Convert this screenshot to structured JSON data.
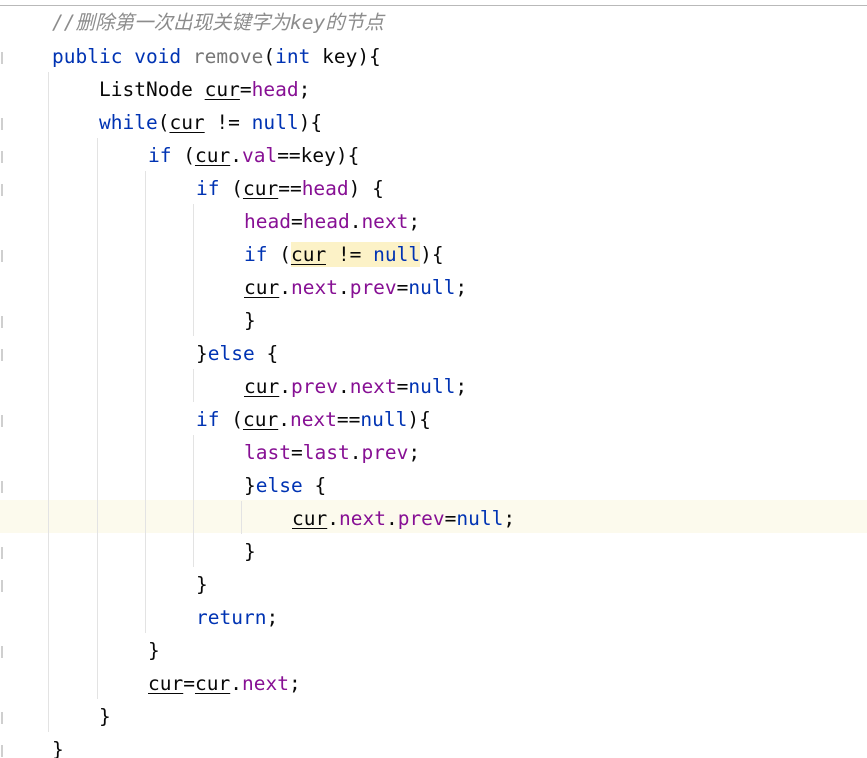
{
  "editor": {
    "language": "Java",
    "current_line_index": 15,
    "colors": {
      "keyword": "#0033b3",
      "field": "#871094",
      "comment": "#8c8c8c",
      "method_unused": "#777777",
      "plain": "#080808",
      "current_line_background": "#fcfaed",
      "match_highlight": "#fcf2c7"
    },
    "lines": [
      {
        "tokens": [
          {
            "t": "//",
            "c": "comment comment-mono"
          },
          {
            "t": "删除第一次出现关键字为",
            "c": "comment"
          },
          {
            "t": "key",
            "c": "comment comment-mono"
          },
          {
            "t": "的节点",
            "c": "comment"
          }
        ]
      },
      {
        "tokens": [
          {
            "t": "public",
            "c": "kw"
          },
          {
            "t": " "
          },
          {
            "t": "void",
            "c": "kw"
          },
          {
            "t": " "
          },
          {
            "t": "remove",
            "c": "gray-method"
          },
          {
            "t": "("
          },
          {
            "t": "int",
            "c": "kw"
          },
          {
            "t": " key){"
          }
        ]
      },
      {
        "tokens": [
          {
            "t": "ListNode "
          },
          {
            "t": "cur",
            "c": "var"
          },
          {
            "t": "="
          },
          {
            "t": "head",
            "c": "field"
          },
          {
            "t": ";"
          }
        ]
      },
      {
        "tokens": [
          {
            "t": "while",
            "c": "kw"
          },
          {
            "t": "("
          },
          {
            "t": "cur",
            "c": "var"
          },
          {
            "t": " != "
          },
          {
            "t": "null",
            "c": "kw"
          },
          {
            "t": "){"
          }
        ]
      },
      {
        "tokens": [
          {
            "t": "if",
            "c": "kw"
          },
          {
            "t": " ("
          },
          {
            "t": "cur",
            "c": "var"
          },
          {
            "t": "."
          },
          {
            "t": "val",
            "c": "field"
          },
          {
            "t": "==key){"
          }
        ]
      },
      {
        "tokens": [
          {
            "t": "if",
            "c": "kw"
          },
          {
            "t": " ("
          },
          {
            "t": "cur",
            "c": "var"
          },
          {
            "t": "=="
          },
          {
            "t": "head",
            "c": "field"
          },
          {
            "t": ") {"
          }
        ]
      },
      {
        "tokens": [
          {
            "t": "head",
            "c": "field"
          },
          {
            "t": "="
          },
          {
            "t": "head",
            "c": "field"
          },
          {
            "t": "."
          },
          {
            "t": "next",
            "c": "field"
          },
          {
            "t": ";"
          }
        ]
      },
      {
        "tokens": [
          {
            "t": "if",
            "c": "kw"
          },
          {
            "t": " ("
          },
          {
            "t": "cur",
            "c": "var hl"
          },
          {
            "t": " != ",
            "c": "hl"
          },
          {
            "t": "null",
            "c": "kw hl"
          },
          {
            "t": "){"
          }
        ]
      },
      {
        "tokens": [
          {
            "t": "cur",
            "c": "var"
          },
          {
            "t": "."
          },
          {
            "t": "next",
            "c": "field"
          },
          {
            "t": "."
          },
          {
            "t": "prev",
            "c": "field"
          },
          {
            "t": "="
          },
          {
            "t": "null",
            "c": "kw"
          },
          {
            "t": ";"
          }
        ]
      },
      {
        "tokens": [
          {
            "t": "}"
          }
        ]
      },
      {
        "tokens": [
          {
            "t": "}"
          },
          {
            "t": "else",
            "c": "kw"
          },
          {
            "t": " {"
          }
        ]
      },
      {
        "tokens": [
          {
            "t": "cur",
            "c": "var"
          },
          {
            "t": "."
          },
          {
            "t": "prev",
            "c": "field"
          },
          {
            "t": "."
          },
          {
            "t": "next",
            "c": "field"
          },
          {
            "t": "="
          },
          {
            "t": "null",
            "c": "kw"
          },
          {
            "t": ";"
          }
        ]
      },
      {
        "tokens": [
          {
            "t": "if",
            "c": "kw"
          },
          {
            "t": " ("
          },
          {
            "t": "cur",
            "c": "var"
          },
          {
            "t": "."
          },
          {
            "t": "next",
            "c": "field"
          },
          {
            "t": "=="
          },
          {
            "t": "null",
            "c": "kw"
          },
          {
            "t": "){"
          }
        ]
      },
      {
        "tokens": [
          {
            "t": "last",
            "c": "field"
          },
          {
            "t": "="
          },
          {
            "t": "last",
            "c": "field"
          },
          {
            "t": "."
          },
          {
            "t": "prev",
            "c": "field"
          },
          {
            "t": ";"
          }
        ]
      },
      {
        "tokens": [
          {
            "t": "}"
          },
          {
            "t": "else",
            "c": "kw"
          },
          {
            "t": " {"
          }
        ]
      },
      {
        "tokens": [
          {
            "t": "cur",
            "c": "var"
          },
          {
            "t": "."
          },
          {
            "t": "next",
            "c": "field"
          },
          {
            "t": "."
          },
          {
            "t": "prev",
            "c": "field"
          },
          {
            "t": "="
          },
          {
            "t": "null",
            "c": "kw"
          },
          {
            "t": ";"
          }
        ]
      },
      {
        "tokens": [
          {
            "t": "}"
          }
        ]
      },
      {
        "tokens": [
          {
            "t": "}"
          }
        ]
      },
      {
        "tokens": [
          {
            "t": "return",
            "c": "kw"
          },
          {
            "t": ";"
          }
        ]
      },
      {
        "tokens": [
          {
            "t": "}"
          }
        ]
      },
      {
        "tokens": [
          {
            "t": "cur",
            "c": "var"
          },
          {
            "t": "="
          },
          {
            "t": "cur",
            "c": "var"
          },
          {
            "t": "."
          },
          {
            "t": "next",
            "c": "field"
          },
          {
            "t": ";"
          }
        ]
      },
      {
        "tokens": [
          {
            "t": "}"
          }
        ]
      },
      {
        "tokens": [
          {
            "t": "}"
          }
        ]
      }
    ]
  }
}
